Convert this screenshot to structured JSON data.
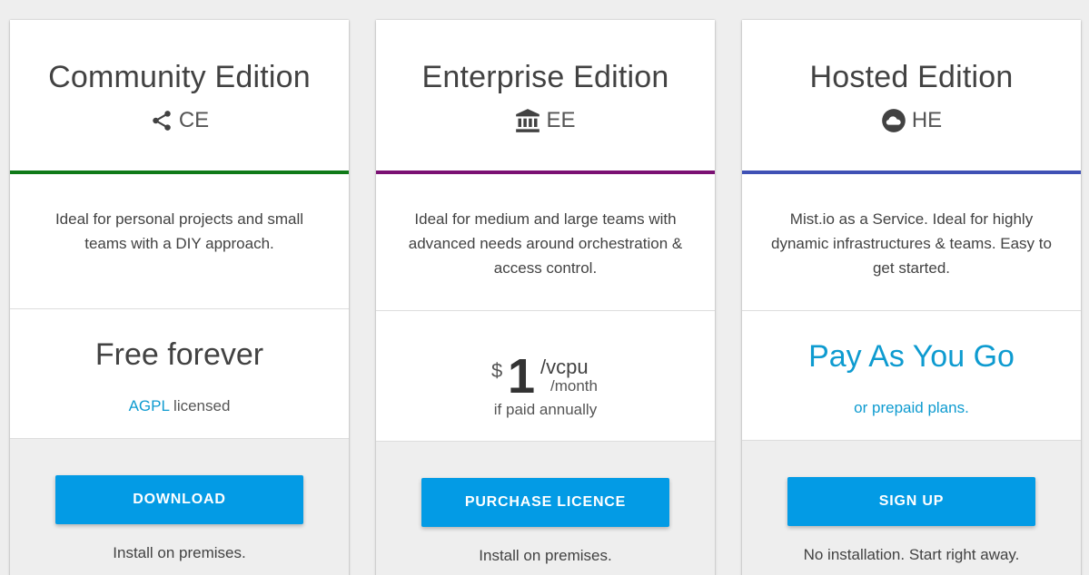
{
  "colors": {
    "community_accent": "#0f7a18",
    "enterprise_accent": "#7b1173",
    "hosted_accent": "#3f51b5",
    "button": "#039be5",
    "link": "#0e9bd0"
  },
  "community": {
    "title": "Community Edition",
    "icon": "share-icon",
    "abbr": "CE",
    "description": "Ideal for personal projects and small teams with a DIY approach.",
    "price": "Free forever",
    "license_link": "AGPL",
    "license_text": " licensed",
    "button_label": "DOWNLOAD",
    "footer": "Install on premises."
  },
  "enterprise": {
    "title": "Enterprise Edition",
    "icon": "bank-icon",
    "abbr": "EE",
    "description": "Ideal for medium and large teams with advanced needs around orchestration & access control.",
    "currency": "$",
    "amount": "1",
    "unit": "/vcpu",
    "period": "/month",
    "note": "if paid annually",
    "button_label": "PURCHASE LICENCE",
    "footer": "Install on premises."
  },
  "hosted": {
    "title": "Hosted Edition",
    "icon": "cloud-icon",
    "abbr": "HE",
    "description": "Mist.io as a Service. Ideal for highly dynamic infrastructures & teams. Easy to get started.",
    "price": "Pay As You Go",
    "note": "or prepaid plans.",
    "button_label": "SIGN UP",
    "footer": "No installation. Start right away."
  }
}
